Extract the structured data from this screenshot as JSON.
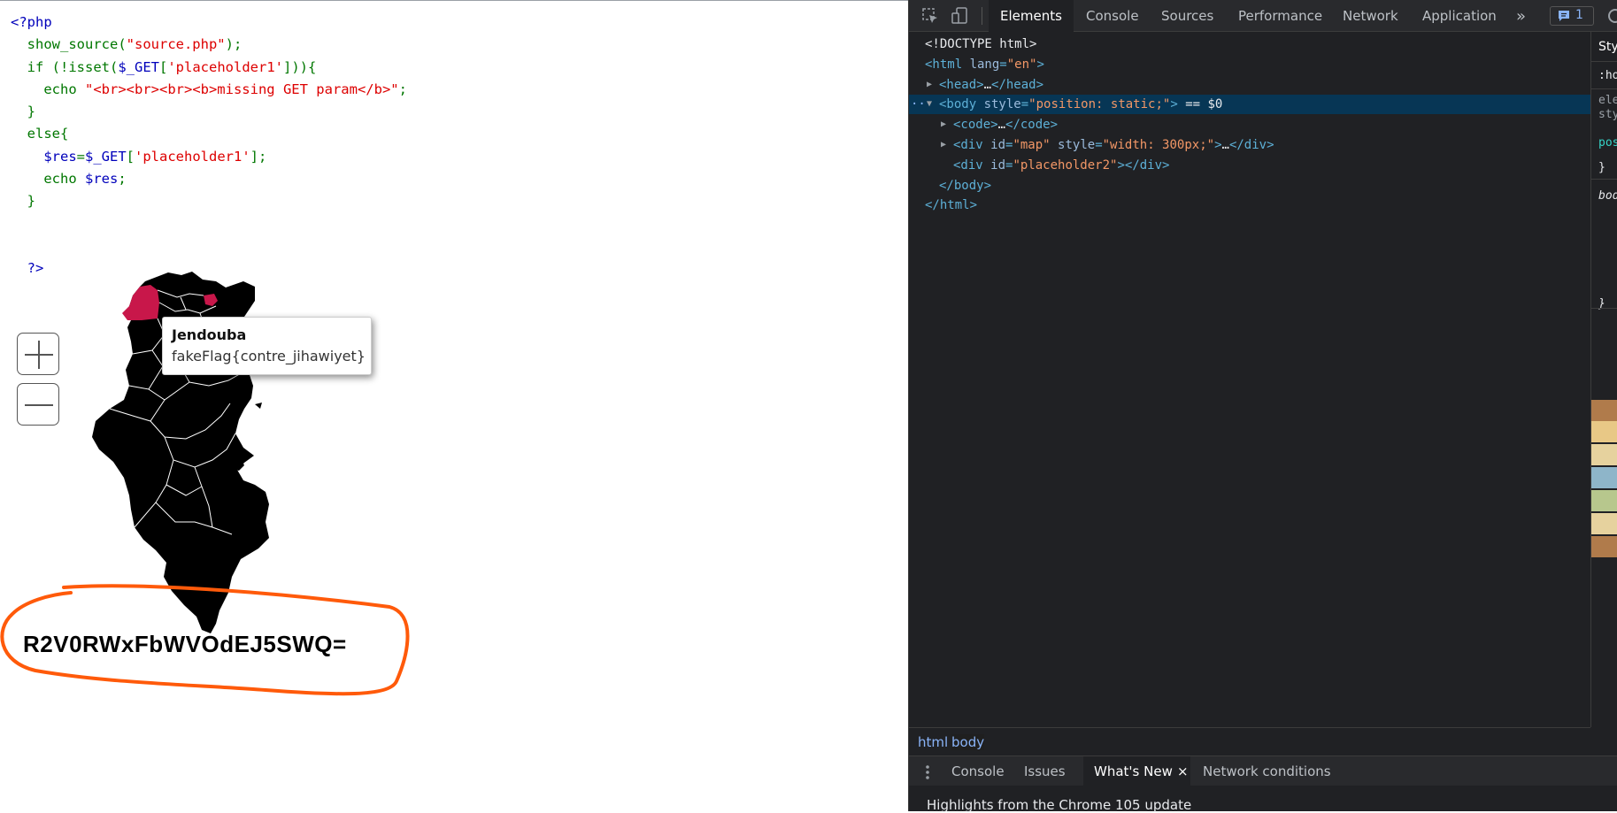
{
  "source_code": {
    "lines": [
      [
        {
          "t": "<?php",
          "c": "blue"
        }
      ],
      [
        {
          "t": "  show_source(",
          "c": "green"
        },
        {
          "t": "\"source.php\"",
          "c": "red"
        },
        {
          "t": ");",
          "c": "green"
        }
      ],
      [
        {
          "t": "  if (!isset(",
          "c": "green"
        },
        {
          "t": "$_GET",
          "c": "blue"
        },
        {
          "t": "[",
          "c": "green"
        },
        {
          "t": "'placeholder1'",
          "c": "red"
        },
        {
          "t": "])){",
          "c": "green"
        }
      ],
      [
        {
          "t": "    echo ",
          "c": "green"
        },
        {
          "t": "\"<br><br><br><b>missing GET param</b>\"",
          "c": "red"
        },
        {
          "t": ";",
          "c": "green"
        }
      ],
      [
        {
          "t": "  }",
          "c": "green"
        }
      ],
      [
        {
          "t": "  else{",
          "c": "green"
        }
      ],
      [
        {
          "t": "    $res",
          "c": "blue"
        },
        {
          "t": "=",
          "c": "green"
        },
        {
          "t": "$_GET",
          "c": "blue"
        },
        {
          "t": "[",
          "c": "green"
        },
        {
          "t": "'placeholder1'",
          "c": "red"
        },
        {
          "t": "];",
          "c": "green"
        }
      ],
      [
        {
          "t": "    echo ",
          "c": "green"
        },
        {
          "t": "$res",
          "c": "blue"
        },
        {
          "t": ";",
          "c": "green"
        }
      ],
      [
        {
          "t": "  }",
          "c": "green"
        }
      ],
      [
        {
          "t": "",
          "c": "green"
        }
      ],
      [
        {
          "t": "",
          "c": "green"
        }
      ],
      [
        {
          "t": "  ?>",
          "c": "blue"
        }
      ]
    ]
  },
  "map": {
    "zoom_in_label": "+",
    "zoom_out_label": "−",
    "tooltip": {
      "region": "Jendouba",
      "value": "fakeFlag{contre_jihawiyet}"
    },
    "colors": {
      "land": "#000000",
      "highlight": "#c8174a",
      "borders": "#ffffff"
    }
  },
  "result": {
    "text": "R2V0RWxFbWVOdEJ5SWQ=",
    "annotation_color": "#ff5a0a"
  },
  "devtools": {
    "tabs": [
      "Elements",
      "Console",
      "Sources",
      "Performance",
      "Network",
      "Application"
    ],
    "active_tab": "Elements",
    "more_tabs": "»",
    "issues_count": "1",
    "styles_tab_fragment": "Sty",
    "dom_lines": [
      {
        "indent": 0,
        "parts": [
          {
            "k": "doctype",
            "t": "<!DOCTYPE html>"
          }
        ]
      },
      {
        "indent": 0,
        "parts": [
          {
            "k": "tag",
            "t": "<html "
          },
          {
            "k": "attr",
            "t": "lang"
          },
          {
            "k": "tag",
            "t": "="
          },
          {
            "k": "aval",
            "t": "\"en\""
          },
          {
            "k": "tag",
            "t": ">"
          }
        ]
      },
      {
        "indent": 1,
        "tri": "▶",
        "parts": [
          {
            "k": "tag",
            "t": "<head>"
          },
          {
            "k": "txt",
            "t": "…"
          },
          {
            "k": "tag",
            "t": "</head>"
          }
        ]
      },
      {
        "indent": 1,
        "tri": "▼",
        "selected": true,
        "parts": [
          {
            "k": "tag",
            "t": "<body "
          },
          {
            "k": "attr",
            "t": "style"
          },
          {
            "k": "tag",
            "t": "="
          },
          {
            "k": "aval",
            "t": "\"position: static;\""
          },
          {
            "k": "tag",
            "t": ">"
          },
          {
            "k": "txt",
            "t": " == $0"
          }
        ]
      },
      {
        "indent": 2,
        "tri": "▶",
        "parts": [
          {
            "k": "tag",
            "t": "<code>"
          },
          {
            "k": "txt",
            "t": "…"
          },
          {
            "k": "tag",
            "t": "</code>"
          }
        ]
      },
      {
        "indent": 2,
        "tri": "▶",
        "parts": [
          {
            "k": "tag",
            "t": "<div "
          },
          {
            "k": "attr",
            "t": "id"
          },
          {
            "k": "tag",
            "t": "="
          },
          {
            "k": "aval",
            "t": "\"map\""
          },
          {
            "k": "attr",
            "t": " style"
          },
          {
            "k": "tag",
            "t": "="
          },
          {
            "k": "aval",
            "t": "\"width: 300px;\""
          },
          {
            "k": "tag",
            "t": ">"
          },
          {
            "k": "txt",
            "t": "…"
          },
          {
            "k": "tag",
            "t": "</div>"
          }
        ]
      },
      {
        "indent": 2,
        "parts": [
          {
            "k": "tag",
            "t": "<div "
          },
          {
            "k": "attr",
            "t": "id"
          },
          {
            "k": "tag",
            "t": "="
          },
          {
            "k": "aval",
            "t": "\"placeholder2\""
          },
          {
            "k": "tag",
            "t": "></div>"
          }
        ]
      },
      {
        "indent": 1,
        "parts": [
          {
            "k": "tag",
            "t": "</body>"
          }
        ]
      },
      {
        "indent": 0,
        "parts": [
          {
            "k": "tag",
            "t": "</html>"
          }
        ]
      }
    ],
    "styles_fragments": [
      ":ho",
      "ele",
      "sty",
      "pos",
      "}",
      "body",
      "}"
    ],
    "breadcrumbs": [
      "html",
      "body"
    ],
    "drawer": {
      "tabs": [
        "Console",
        "Issues",
        "What's New",
        "Network conditions"
      ],
      "active_tab": "What's New",
      "close_glyph": "×",
      "heading": "Highlights from the Chrome 105 update"
    }
  }
}
